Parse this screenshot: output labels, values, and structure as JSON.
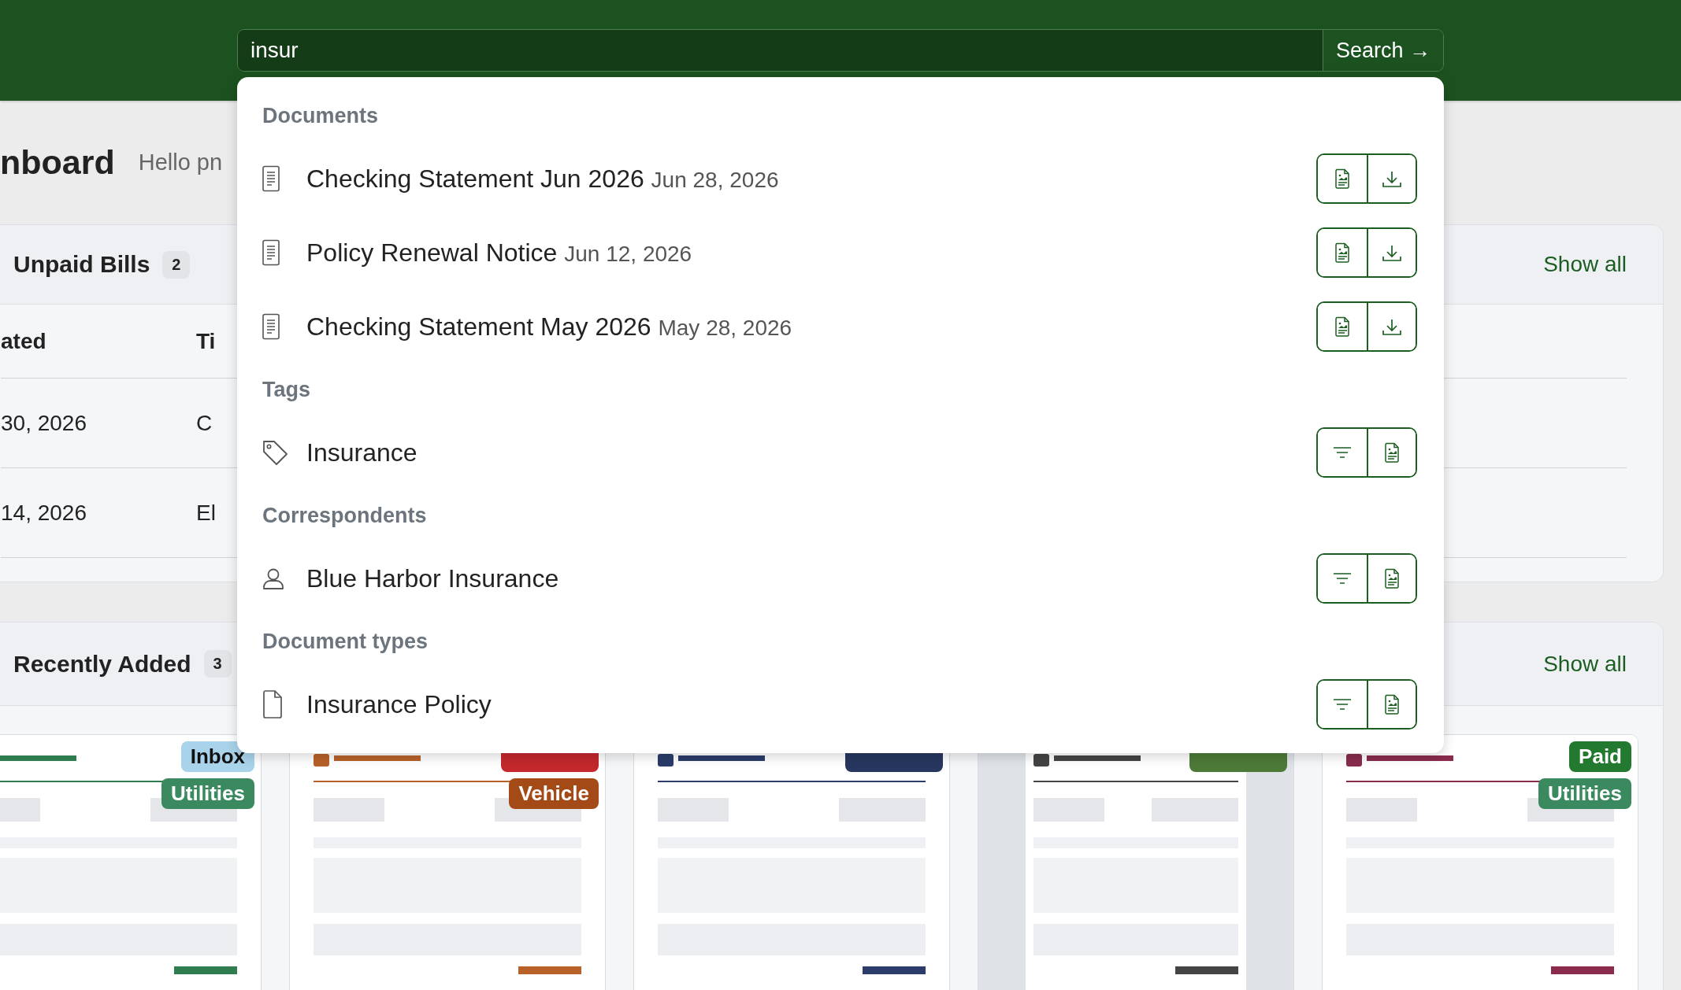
{
  "header": {
    "search": {
      "value": "insur"
    },
    "search_button": {
      "label": "Search →"
    }
  },
  "page": {
    "title": "nboard",
    "greeting": "Hello pn"
  },
  "unpaid_bills": {
    "title": "Unpaid Bills",
    "count": "2",
    "action": "Show all",
    "columns": [
      "ated",
      "Ti"
    ],
    "rows": [
      [
        "30, 2026",
        "C"
      ],
      [
        "14, 2026",
        "El"
      ]
    ]
  },
  "recently_added": {
    "title": "Recently Added",
    "count": "3",
    "action": "Show all",
    "documents": [
      {
        "kind": "picture",
        "tags": [
          {
            "label": "Inbox",
            "color": "#a9d3ea"
          },
          {
            "label": "Utilities",
            "color": "#3b8a5f"
          }
        ]
      },
      {
        "kind": "picture",
        "tags": [
          {
            "color": "#c3282d"
          },
          {
            "label": "Vehicle",
            "color": "#a34a17"
          }
        ]
      },
      {
        "kind": "picture",
        "tags": [
          {
            "color": "#27375f"
          }
        ]
      },
      {
        "kind": "picture",
        "tags": [
          {
            "color": "#4d7a38"
          }
        ]
      },
      {
        "kind": "picture",
        "tags": [
          {
            "label": "Paid",
            "color": "#22792f"
          },
          {
            "label": "Utilities",
            "color": "#3b8a5f"
          }
        ]
      }
    ]
  },
  "search_results": {
    "groups": [
      {
        "heading": "Documents",
        "items": [
          {
            "kind": "document",
            "title": "Checking Statement Jun 2026",
            "date": "Jun 28, 2026"
          },
          {
            "kind": "document",
            "title": "Policy Renewal Notice",
            "date": "Jun 12, 2026"
          },
          {
            "kind": "document",
            "title": "Checking Statement May 2026",
            "date": "May 28, 2026"
          }
        ]
      },
      {
        "heading": "Tags",
        "items": [
          {
            "kind": "tag",
            "title": "Insurance"
          }
        ]
      },
      {
        "heading": "Correspondents",
        "items": [
          {
            "kind": "correspondent",
            "title": "Blue Harbor Insurance"
          }
        ]
      },
      {
        "heading": "Document types",
        "items": [
          {
            "kind": "document_type",
            "title": "Insurance Policy"
          }
        ]
      }
    ]
  }
}
